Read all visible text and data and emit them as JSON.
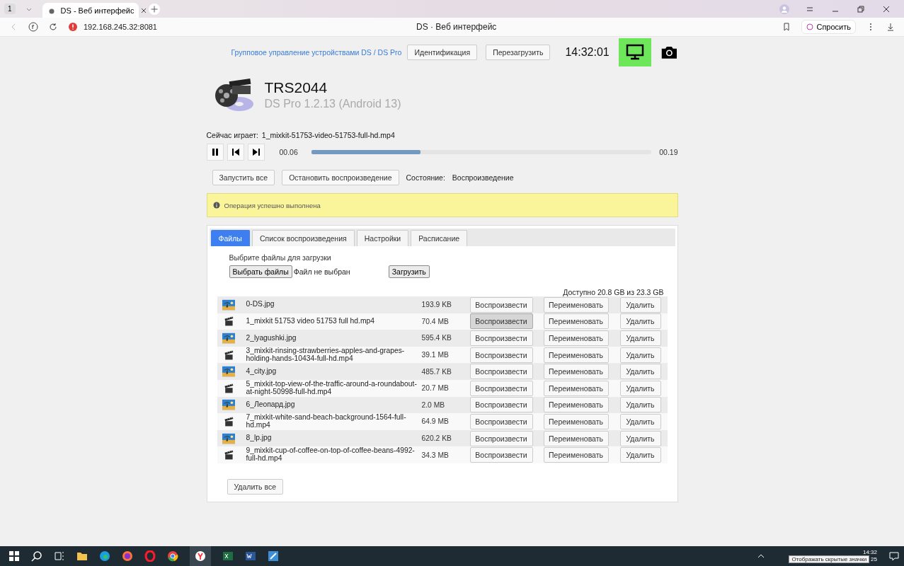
{
  "browser": {
    "tab_count": "1",
    "tab_title": "DS - Веб интерфейс",
    "url": "192.168.245.32:8081",
    "page_title": "DS · Веб интерфейс",
    "ask_button": "Спросить"
  },
  "top_bar": {
    "group_link": "Групповое управление устройствами DS / DS Pro",
    "buttons": [
      "Идентификация",
      "Перезагрузить"
    ],
    "clock": "14:32:01",
    "screen_on": true
  },
  "device": {
    "name": "TRS2044",
    "version": "DS Pro 1.2.13 (Android 13)"
  },
  "now_playing": {
    "label": "Сейчас играет:",
    "file": "1_mixkit-51753-video-51753-full-hd.mp4"
  },
  "player": {
    "elapsed": "00.06",
    "total": "00.19",
    "level": 0.32
  },
  "controls": {
    "buttons": [
      "Запустить все",
      "Остановить воспроизведение"
    ],
    "state_label": "Состояние:",
    "state": "Воспроизведение"
  },
  "alert": {
    "text": "Операция успешно выполнена"
  },
  "tabs": [
    {
      "label": "Файлы",
      "selected": true
    },
    {
      "label": "Список воспроизведения",
      "selected": false
    },
    {
      "label": "Настройки",
      "selected": false
    },
    {
      "label": "Расписание",
      "selected": false
    }
  ],
  "upload": {
    "label": "Выбрите файлы для загрузки",
    "choose_button": "Выбрать файлы",
    "no_file": "Файл не выбран",
    "upload_button": "Загрузить"
  },
  "storage": "Доступно 20.8 GB из 23.3 GB",
  "files": [
    {
      "kind": "image",
      "name": "0-DS.jpg",
      "size": "193.9 KB",
      "play": "Воспроизвести",
      "rename": "Переименовать",
      "delete": "Удалить",
      "active": false
    },
    {
      "kind": "video",
      "name": "1_mixkit 51753 video 51753 full hd.mp4",
      "size": "70.4 MB",
      "play": "Воспроизвести",
      "rename": "Переименовать",
      "delete": "Удалить",
      "active": true
    },
    {
      "kind": "image",
      "name": "2_lyagushki.jpg",
      "size": "595.4 KB",
      "play": "Воспроизвести",
      "rename": "Переименовать",
      "delete": "Удалить",
      "active": false
    },
    {
      "kind": "video",
      "name": "3_mixkit-rinsing-strawberries-apples-and-grapes-holding-hands-10434-full-hd.mp4",
      "size": "39.1 MB",
      "play": "Воспроизвести",
      "rename": "Переименовать",
      "delete": "Удалить",
      "active": false
    },
    {
      "kind": "image",
      "name": "4_city.jpg",
      "size": "485.7 KB",
      "play": "Воспроизвести",
      "rename": "Переименовать",
      "delete": "Удалить",
      "active": false
    },
    {
      "kind": "video",
      "name": "5_mixkit-top-view-of-the-traffic-around-a-roundabout-at-night-50998-full-hd.mp4",
      "size": "20.7 MB",
      "play": "Воспроизвести",
      "rename": "Переименовать",
      "delete": "Удалить",
      "active": false
    },
    {
      "kind": "image",
      "name": "6_Леопард.jpg",
      "size": "2.0 MB",
      "play": "Воспроизвести",
      "rename": "Переименовать",
      "delete": "Удалить",
      "active": false
    },
    {
      "kind": "video",
      "name": "7_mixkit-white-sand-beach-background-1564-full-hd.mp4",
      "size": "64.9 MB",
      "play": "Воспроизвести",
      "rename": "Переименовать",
      "delete": "Удалить",
      "active": false
    },
    {
      "kind": "image",
      "name": "8_lp.jpg",
      "size": "620.2 KB",
      "play": "Воспроизвести",
      "rename": "Переименовать",
      "delete": "Удалить",
      "active": false
    },
    {
      "kind": "video",
      "name": "9_mixkit-cup-of-coffee-on-top-of-coffee-beans-4992-full-hd.mp4",
      "size": "34.3 MB",
      "play": "Воспроизвести",
      "rename": "Переименовать",
      "delete": "Удалить",
      "active": false
    }
  ],
  "delete_all": "Удалить все",
  "taskbar": {
    "time": "14:32",
    "date": "25",
    "tooltip": "Отображать скрытые значки"
  }
}
